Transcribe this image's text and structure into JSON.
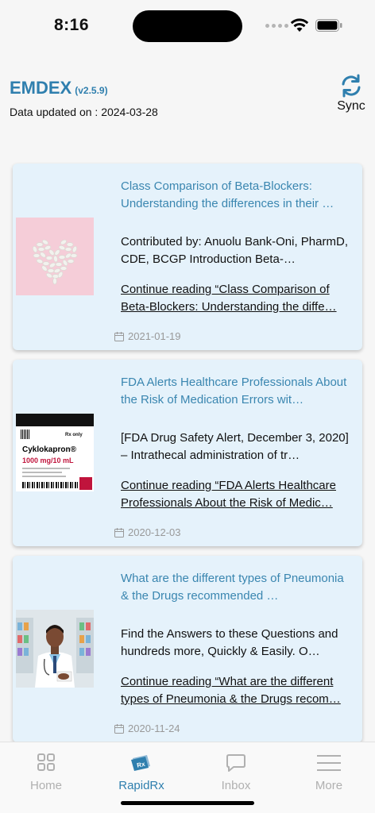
{
  "status": {
    "time": "8:16"
  },
  "header": {
    "app_name": "EMDEX",
    "version": "(v2.5.9)",
    "updated": "Data updated on : 2024-03-28",
    "sync_label": "Sync"
  },
  "articles": [
    {
      "title": "Class Comparison of Beta-Blockers: Understanding the differences in their …",
      "excerpt": "Contributed by: Anuolu Bank-Oni, PharmD, CDE, BCGP Introduction Beta-…",
      "link": "Continue reading “Class Comparison of Beta-Blockers: Understanding the diffe…",
      "date": "2021-01-19",
      "thumb": "pills-heart-image"
    },
    {
      "title": "FDA Alerts Healthcare Professionals About the Risk of Medication Errors wit…",
      "excerpt": "[FDA Drug Safety Alert, December 3, 2020] – Intrathecal administration of tr…",
      "link": "Continue reading “FDA Alerts Healthcare Professionals About the Risk of Medic…",
      "date": "2020-12-03",
      "thumb": "cyklokapron-ampule-image",
      "thumb_text": {
        "brand": "Cyklokapron®",
        "dose": "1000 mg/10 mL",
        "rx": "Rx only"
      }
    },
    {
      "title": "What are the different types of Pneumonia & the Drugs recommended …",
      "excerpt": "Find the Answers to these Questions and hundreds more, Quickly & Easily. O…",
      "link": "Continue reading “What are the different types of Pneumonia & the Drugs recom…",
      "date": "2020-11-24",
      "thumb": "pharmacist-image"
    }
  ],
  "tabs": [
    {
      "label": "Home",
      "icon": "grid-icon",
      "active": false
    },
    {
      "label": "RapidRx",
      "icon": "rx-icon",
      "active": true
    },
    {
      "label": "Inbox",
      "icon": "chat-icon",
      "active": false
    },
    {
      "label": "More",
      "icon": "menu-icon",
      "active": false
    }
  ],
  "colors": {
    "accent": "#2f7fae",
    "card_bg": "#e5f2fb",
    "inactive": "#b0b0b0"
  }
}
